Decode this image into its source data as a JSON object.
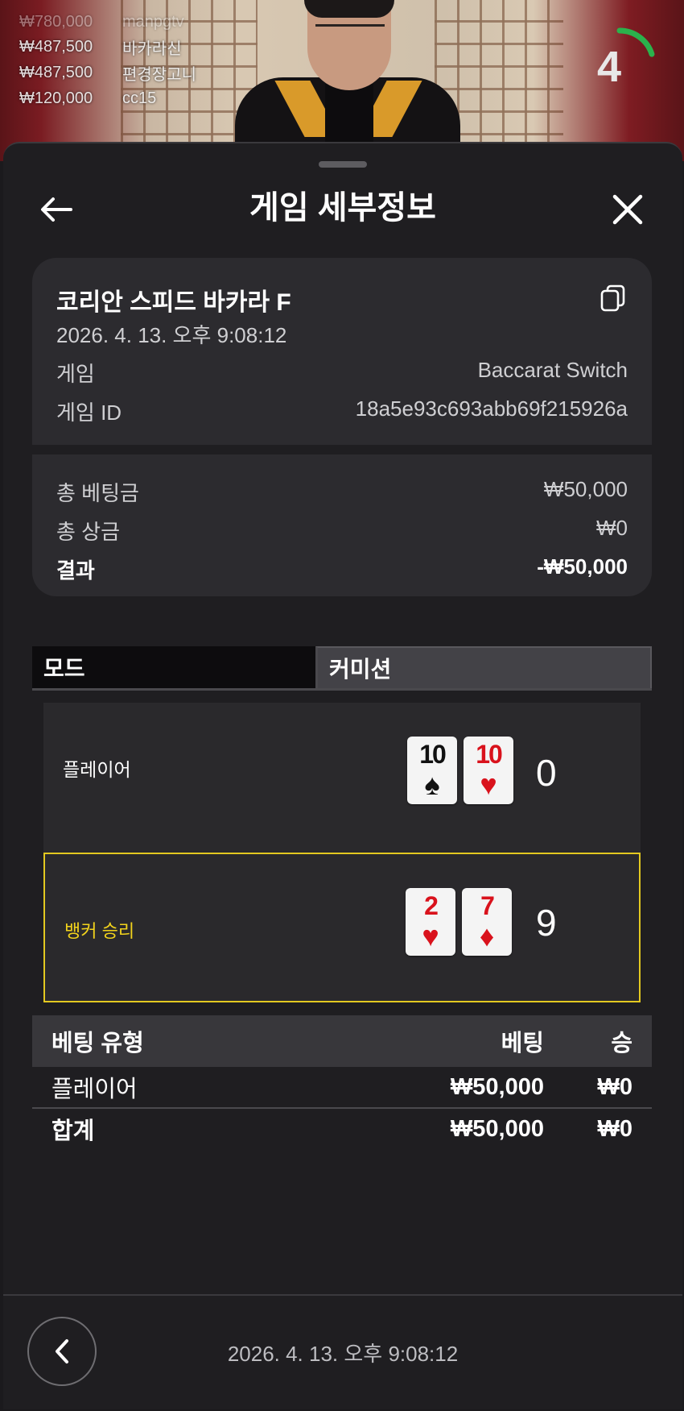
{
  "winners": [
    {
      "amount": "₩780,000",
      "name": "manpgtv"
    },
    {
      "amount": "₩487,500",
      "name": "바카라신"
    },
    {
      "amount": "₩487,500",
      "name": "편경장고니"
    },
    {
      "amount": "₩120,000",
      "name": "cc15"
    }
  ],
  "timer": {
    "seconds": "4",
    "progress": 0.2,
    "color": "#2bb24c"
  },
  "header": {
    "title": "게임 세부정보",
    "back_icon": "arrow-left-icon",
    "close_icon": "close-icon"
  },
  "game": {
    "table_name": "코리안 스피드 바카라 F",
    "datetime": "2026. 4. 13. 오후 9:08:12",
    "game_label": "게임",
    "game_value": "Baccarat Switch",
    "id_label": "게임 ID",
    "id_value": "18a5e93c693abb69f215926a"
  },
  "summary": {
    "total_bet_label": "총 베팅금",
    "total_bet_value": "₩50,000",
    "total_win_label": "총 상금",
    "total_win_value": "₩0",
    "result_label": "결과",
    "result_value": "-₩50,000"
  },
  "mode": {
    "tab_mode": "모드",
    "tab_commission": "커미션"
  },
  "hands": {
    "player": {
      "label": "플레이어",
      "cards": [
        {
          "rank": "10",
          "suit": "♠",
          "color": "black"
        },
        {
          "rank": "10",
          "suit": "♥",
          "color": "red"
        }
      ],
      "score": "0"
    },
    "banker": {
      "label": "뱅커 승리",
      "cards": [
        {
          "rank": "2",
          "suit": "♥",
          "color": "red"
        },
        {
          "rank": "7",
          "suit": "♦",
          "color": "red"
        }
      ],
      "score": "9"
    }
  },
  "bets": {
    "headers": {
      "type": "베팅 유형",
      "bet": "베팅",
      "win": "승"
    },
    "rows": [
      {
        "type": "플레이어",
        "bet": "₩50,000",
        "win": "₩0"
      }
    ],
    "total": {
      "type": "합계",
      "bet": "₩50,000",
      "win": "₩0"
    }
  },
  "footer": {
    "datetime": "2026. 4. 13. 오후 9:08:12"
  },
  "colors": {
    "highlight": "#e3c820",
    "banker_text": "#f2d31c",
    "card_red": "#d9121c"
  }
}
